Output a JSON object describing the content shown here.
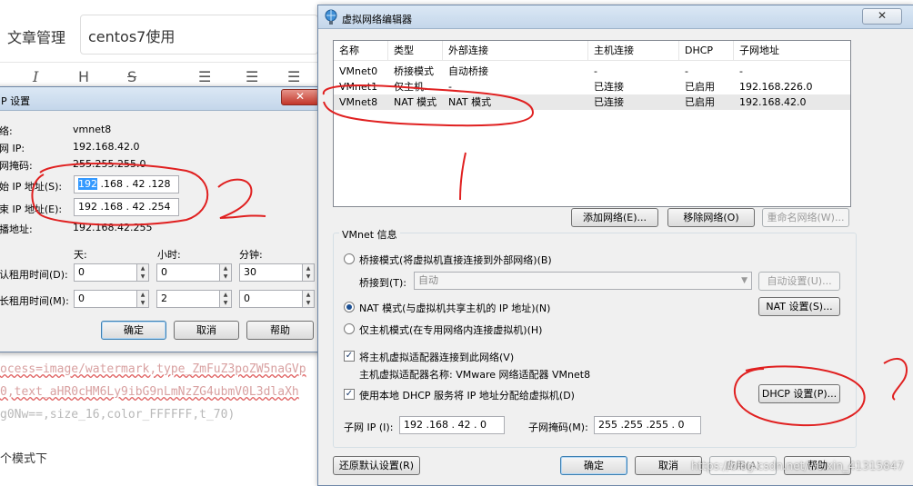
{
  "editor": {
    "title_label": "文章管理",
    "title_value": "centos7使用",
    "toolbar_icons": [
      "italic-icon",
      "heading-icon",
      "strikethrough-icon",
      "unordered-list-icon",
      "ordered-list-icon",
      "task-list-icon"
    ],
    "md_line1": "ocess=image/watermark,type_ZmFuZ3poZW5naGVp",
    "md_line2": "0,text_aHR0cHM6Ly9ibG9nLmNzZG4ubmV0L3dlaXh",
    "md_line3": "g0Nw==,size_16,color_FFFFFF,t_70)",
    "md_text": "个模式下"
  },
  "dhcp": {
    "title": "P 设置",
    "close_glyph": "✕",
    "rows": [
      {
        "label": "络:",
        "value": "vmnet8"
      },
      {
        "label": "网 IP:",
        "value": "192.168.42.0"
      },
      {
        "label": "网掩码:",
        "value": "255.255.255.0"
      }
    ],
    "start_label": "始 IP 地址(S):",
    "start_sel": "192",
    "start_rest": " .168 . 42 .128",
    "end_label": "束 IP 地址(E):",
    "end_value": "192 .168 . 42 .254",
    "broadcast_label": "播地址:",
    "broadcast_value": "192.168.42.255",
    "col_days": "天:",
    "col_hours": "小时:",
    "col_minutes": "分钟:",
    "default_lease_label": "认租用时间(D):",
    "default_lease": [
      "0",
      "0",
      "30"
    ],
    "max_lease_label": "长租用时间(M):",
    "max_lease": [
      "0",
      "2",
      "0"
    ],
    "ok": "确定",
    "cancel": "取消",
    "help": "帮助"
  },
  "vne": {
    "title": "虚拟网络编辑器",
    "close_glyph": "✕",
    "columns": [
      "名称",
      "类型",
      "外部连接",
      "主机连接",
      "DHCP",
      "子网地址"
    ],
    "rows": [
      {
        "name": "VMnet0",
        "type": "桥接模式",
        "external": "自动桥接",
        "host": "-",
        "dhcp": "-",
        "subnet": "-"
      },
      {
        "name": "VMnet1",
        "type": "仅主机...",
        "external": "-",
        "host": "已连接",
        "dhcp": "已启用",
        "subnet": "192.168.226.0"
      },
      {
        "name": "VMnet8",
        "type": "NAT 模式",
        "external": "NAT 模式",
        "host": "已连接",
        "dhcp": "已启用",
        "subnet": "192.168.42.0"
      }
    ],
    "add_network": "添加网络(E)...",
    "remove_network": "移除网络(O)",
    "rename_network": "重命名网络(W)...",
    "group_title": "VMnet 信息",
    "bridge_mode": "桥接模式(将虚拟机直接连接到外部网络)(B)",
    "bridge_to": "桥接到(T):",
    "bridge_value": "自动",
    "auto_settings": "自动设置(U)...",
    "nat_mode": "NAT 模式(与虚拟机共享主机的 IP 地址)(N)",
    "nat_settings": "NAT 设置(S)...",
    "host_only": "仅主机模式(在专用网络内连接虚拟机)(H)",
    "connect_adapter": "将主机虚拟适配器连接到此网络(V)",
    "adapter_name": "主机虚拟适配器名称: VMware 网络适配器 VMnet8",
    "use_dhcp": "使用本地 DHCP 服务将 IP 地址分配给虚拟机(D)",
    "dhcp_settings": "DHCP 设置(P)...",
    "subnet_ip_label": "子网 IP (I):",
    "subnet_ip": "192 .168 . 42 . 0",
    "subnet_mask_label": "子网掩码(M):",
    "subnet_mask": "255 .255 .255 . 0",
    "restore_defaults": "还原默认设置(R)",
    "ok": "确定",
    "cancel": "取消",
    "apply": "应用(A)",
    "help": "帮助"
  },
  "watermark": "https://blog.csdn.net/weixin_41315847"
}
